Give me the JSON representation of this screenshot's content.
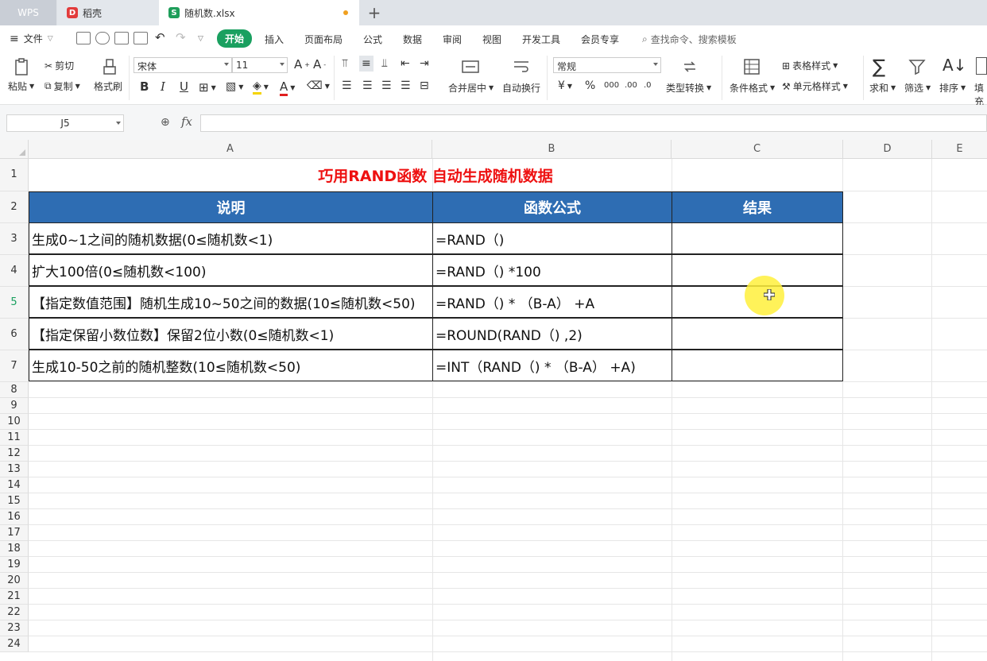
{
  "tabs": {
    "wps": "WPS",
    "daoke": "稻壳",
    "file": "随机数.xlsx",
    "add": "+"
  },
  "menu": {
    "file": "文件",
    "items": [
      "开始",
      "插入",
      "页面布局",
      "公式",
      "数据",
      "审阅",
      "视图",
      "开发工具",
      "会员专享"
    ],
    "search": "查找命令、搜索模板"
  },
  "ribbon": {
    "paste": "粘贴",
    "cut": "剪切",
    "copy": "复制",
    "format_painter": "格式刷",
    "font": "宋体",
    "size": "11",
    "bold": "B",
    "italic": "I",
    "underline": "U",
    "merge": "合并居中",
    "wrap": "自动换行",
    "number_format": "常规",
    "type_convert": "类型转换",
    "cond_format": "条件格式",
    "table_style": "表格样式",
    "cell_style": "单元格样式",
    "sum": "求和",
    "filter": "筛选",
    "sort": "排序",
    "fill": "填充"
  },
  "formula_bar": {
    "name": "J5",
    "fx": "fx",
    "value": ""
  },
  "columns": [
    "A",
    "B",
    "C",
    "D",
    "E"
  ],
  "rows": [
    "1",
    "2",
    "3",
    "4",
    "5",
    "6",
    "7",
    "8",
    "9",
    "10",
    "11",
    "12",
    "13",
    "14",
    "15",
    "16",
    "17",
    "18",
    "19",
    "20",
    "21",
    "22",
    "23",
    "24"
  ],
  "selected_row": "5",
  "sheet": {
    "title": "巧用RAND函数 自动生成随机数据",
    "headers": [
      "说明",
      "函数公式",
      "结果"
    ],
    "data": [
      [
        "生成0~1之间的随机数据(0≤随机数<1)",
        "=RAND（)",
        ""
      ],
      [
        "扩大100倍(0≤随机数<100)",
        "=RAND（)  *100",
        ""
      ],
      [
        "【指定数值范围】随机生成10~50之间的数据(10≤随机数<50)",
        "=RAND（)  * （B-A） +A",
        ""
      ],
      [
        "【指定保留小数位数】保留2位小数(0≤随机数<1)",
        "=ROUND(RAND（) ,2)",
        ""
      ],
      [
        "生成10-50之前的随机整数(10≤随机数<50)",
        "=INT（RAND（) * （B-A） +A)",
        ""
      ]
    ]
  },
  "colors": {
    "accent": "#1aa060",
    "header_fill": "#2e6db3",
    "title_red": "#ee1111",
    "cursor_highlight": "#fff03c"
  }
}
